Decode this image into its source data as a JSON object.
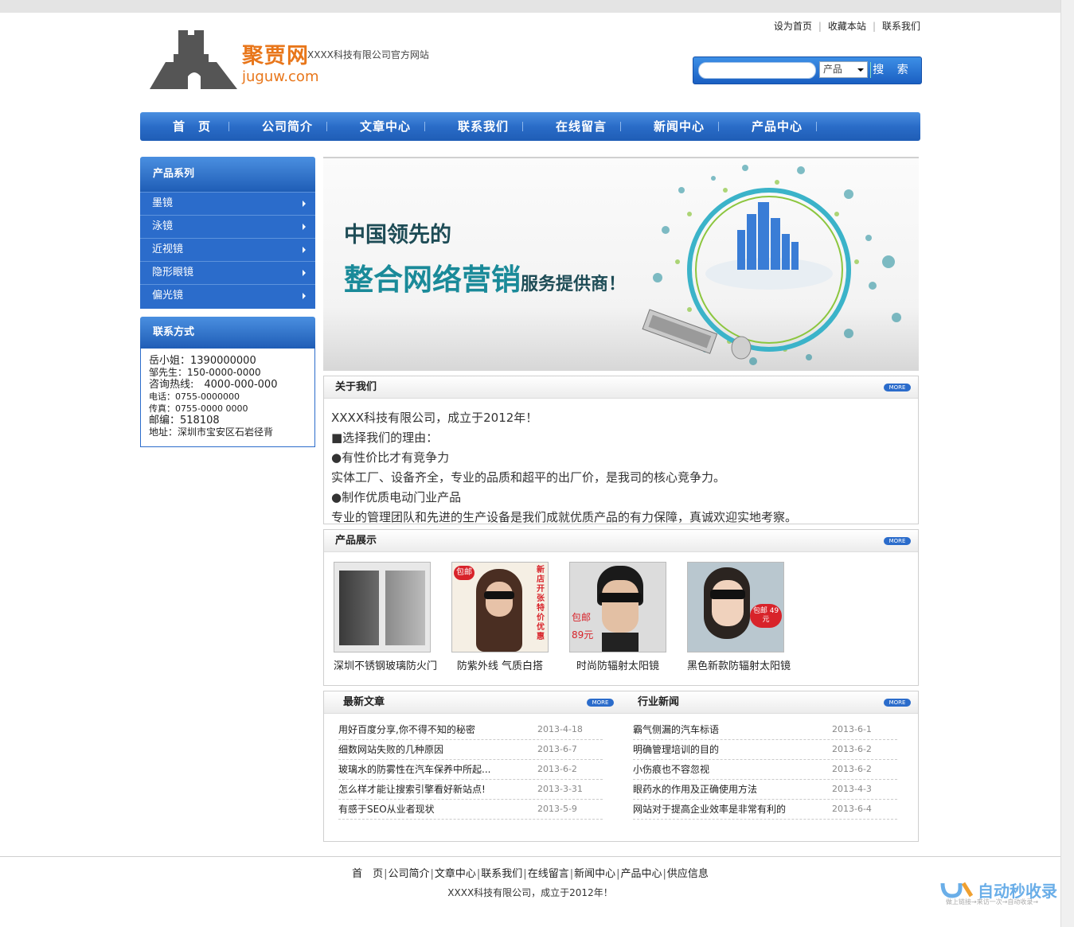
{
  "header": {
    "brand_cn": "聚贾网",
    "brand_en": "juguw.com",
    "slogan": "XXXX科技有限公司官方网站",
    "top_links": [
      "设为首页",
      "收藏本站",
      "联系我们"
    ],
    "search": {
      "placeholder": "",
      "select_value": "产品",
      "button": "搜 索"
    }
  },
  "nav": [
    "首　页",
    "公司简介",
    "文章中心",
    "联系我们",
    "在线留言",
    "新闻中心",
    "产品中心"
  ],
  "sidebar": {
    "categories_title": "产品系列",
    "categories": [
      "墨镜",
      "泳镜",
      "近视镜",
      "隐形眼镜",
      "偏光镜"
    ],
    "contact_title": "联系方式",
    "contact_lines": [
      "岳小姐：1390000000",
      "邹先生：150-0000-0000",
      "咨询热线:　4000-000-000",
      "电话：0755-0000000",
      "传真：0755-0000 0000",
      "邮编：518108",
      "地址：深圳市宝安区石岩径背"
    ]
  },
  "banner": {
    "line1": "中国领先的",
    "line2_big": "整合网络营销",
    "line2_small": "服务提供商！"
  },
  "about": {
    "title": "关于我们",
    "more": "MORE",
    "lines": [
      "XXXX科技有限公司，成立于2012年！",
      "■选择我们的理由：",
      "●有性价比才有竞争力",
      "实体工厂、设备齐全，专业的品质和超平的出厂价，是我司的核心竞争力。",
      "●制作优质电动门业产品",
      "专业的管理团队和先进的生产设备是我们成就优质产品的有力保障，真诚欢迎实地考察。"
    ]
  },
  "products": {
    "title": "产品展示",
    "more": "MORE",
    "items": [
      {
        "caption": "深圳不锈钢玻璃防火门"
      },
      {
        "caption": "防紫外线 气质白搭",
        "badge": "包邮",
        "side_text": "新店开张 特价优惠"
      },
      {
        "caption": "时尚防辐射太阳镜",
        "badge": "包邮",
        "price": "89元"
      },
      {
        "caption": "黑色新款防辐射太阳镜",
        "badge": "包邮 49元"
      }
    ]
  },
  "articles": {
    "title": "最新文章",
    "more": "MORE",
    "rows": [
      {
        "title": "用好百度分享,你不得不知的秘密",
        "date": "2013-4-18"
      },
      {
        "title": "细数网站失败的几种原因",
        "date": "2013-6-7"
      },
      {
        "title": "玻璃水的防雾性在汽车保养中所起...",
        "date": "2013-6-2"
      },
      {
        "title": "怎么样才能让搜索引擎看好新站点!",
        "date": "2013-3-31"
      },
      {
        "title": "有感于SEO从业者现状",
        "date": "2013-5-9"
      }
    ]
  },
  "industry": {
    "title": "行业新闻",
    "more": "MORE",
    "rows": [
      {
        "title": "霸气侧漏的汽车标语",
        "date": "2013-6-1"
      },
      {
        "title": "明确管理培训的目的",
        "date": "2013-6-2"
      },
      {
        "title": "小伤痕也不容忽视",
        "date": "2013-6-2"
      },
      {
        "title": "眼药水的作用及正确使用方法",
        "date": "2013-4-3"
      },
      {
        "title": "网站对于提高企业效率是非常有利的",
        "date": "2013-6-4"
      }
    ]
  },
  "footer": {
    "links": [
      "首　页",
      "公司简介",
      "文章中心",
      "联系我们",
      "在线留言",
      "新闻中心",
      "产品中心",
      "供应信息"
    ],
    "copy": "XXXX科技有限公司，成立于2012年！"
  },
  "watermark": {
    "text": "自动秒收录",
    "sub": "做上链接→来访一次→自动收录→"
  },
  "colors": {
    "nav_blue": "#2b6ccb",
    "brand_orange": "#e8761a",
    "banner_teal": "#1a8a99"
  }
}
